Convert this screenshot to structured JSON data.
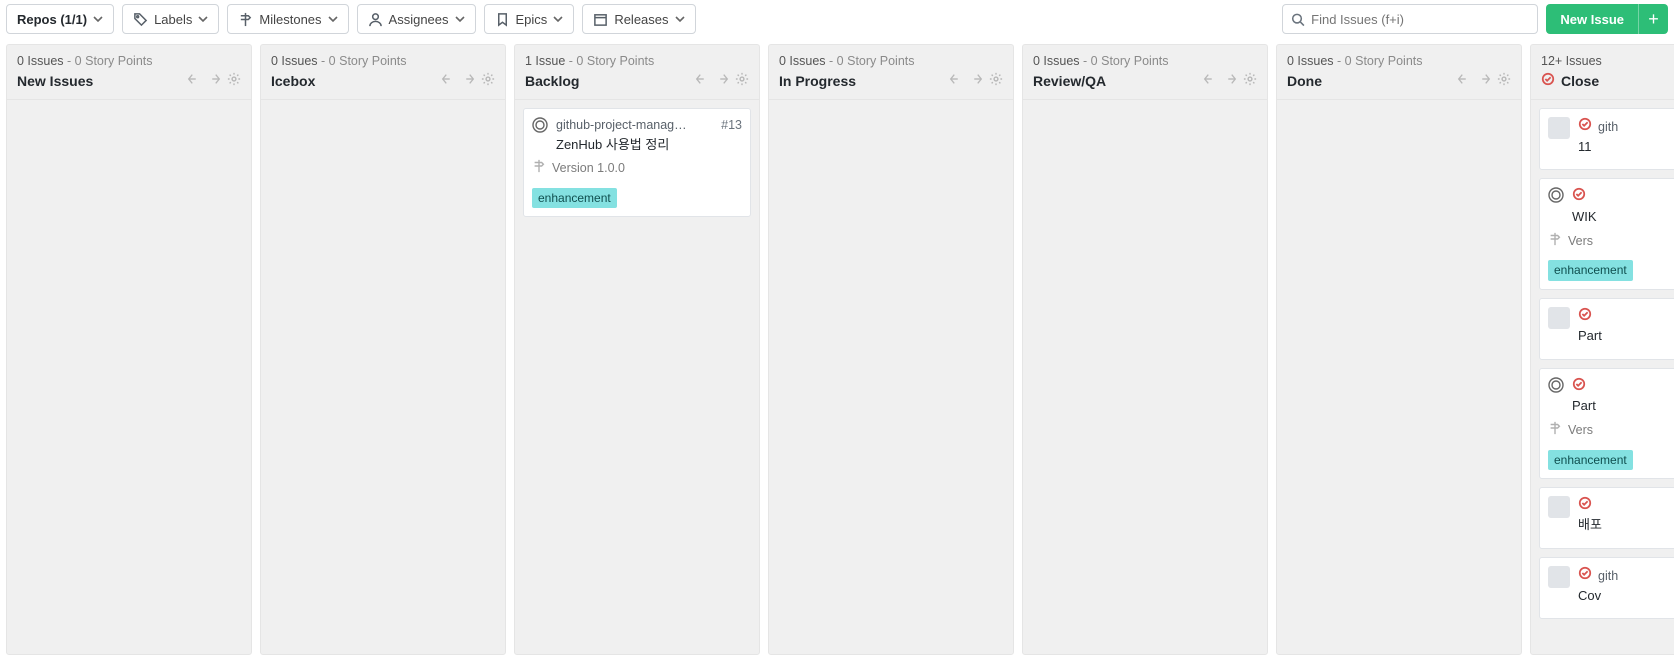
{
  "toolbar": {
    "repos_label": "Repos (1/1)",
    "labels_label": "Labels",
    "milestones_label": "Milestones",
    "assignees_label": "Assignees",
    "epics_label": "Epics",
    "releases_label": "Releases"
  },
  "search": {
    "placeholder": "Find Issues (f+i)"
  },
  "actions": {
    "new_issue_label": "New Issue"
  },
  "columns": [
    {
      "issues_text": "0 Issues",
      "points_text": "0 Story Points",
      "title": "New Issues",
      "has_closed_icon": false,
      "cards": []
    },
    {
      "issues_text": "0 Issues",
      "points_text": "0 Story Points",
      "title": "Icebox",
      "has_closed_icon": false,
      "cards": []
    },
    {
      "issues_text": "1 Issue",
      "points_text": "0 Story Points",
      "title": "Backlog",
      "has_closed_icon": false,
      "cards": [
        {
          "repo": "github-project-manag…",
          "number": "#13",
          "title": "ZenHub 사용법 정리",
          "milestone": "Version 1.0.0",
          "labels": [
            "enhancement"
          ],
          "has_avatar": false
        }
      ]
    },
    {
      "issues_text": "0 Issues",
      "points_text": "0 Story Points",
      "title": "In Progress",
      "has_closed_icon": false,
      "cards": []
    },
    {
      "issues_text": "0 Issues",
      "points_text": "0 Story Points",
      "title": "Review/QA",
      "has_closed_icon": false,
      "cards": []
    },
    {
      "issues_text": "0 Issues",
      "points_text": "0 Story Points",
      "title": "Done",
      "has_closed_icon": false,
      "cards": []
    },
    {
      "issues_text": "12+ Issues",
      "points_text": "",
      "title": "Close",
      "has_closed_icon": true,
      "cards": [
        {
          "repo": "gith",
          "number": "",
          "title": "11",
          "milestone": "",
          "labels": [],
          "has_avatar": true
        },
        {
          "repo": "",
          "number": "",
          "title": "WIK",
          "milestone": "Vers",
          "labels": [
            "enhancement"
          ],
          "has_avatar": false
        },
        {
          "repo": "",
          "number": "",
          "title": "Part",
          "milestone": "",
          "labels": [],
          "has_avatar": true
        },
        {
          "repo": "",
          "number": "",
          "title": "Part",
          "milestone": "Vers",
          "labels": [
            "enhancement"
          ],
          "has_avatar": false
        },
        {
          "repo": "",
          "number": "",
          "title": "배포",
          "milestone": "",
          "labels": [],
          "has_avatar": true
        },
        {
          "repo": "gith",
          "number": "",
          "title": "Cov",
          "milestone": "",
          "labels": [],
          "has_avatar": true
        }
      ]
    }
  ]
}
